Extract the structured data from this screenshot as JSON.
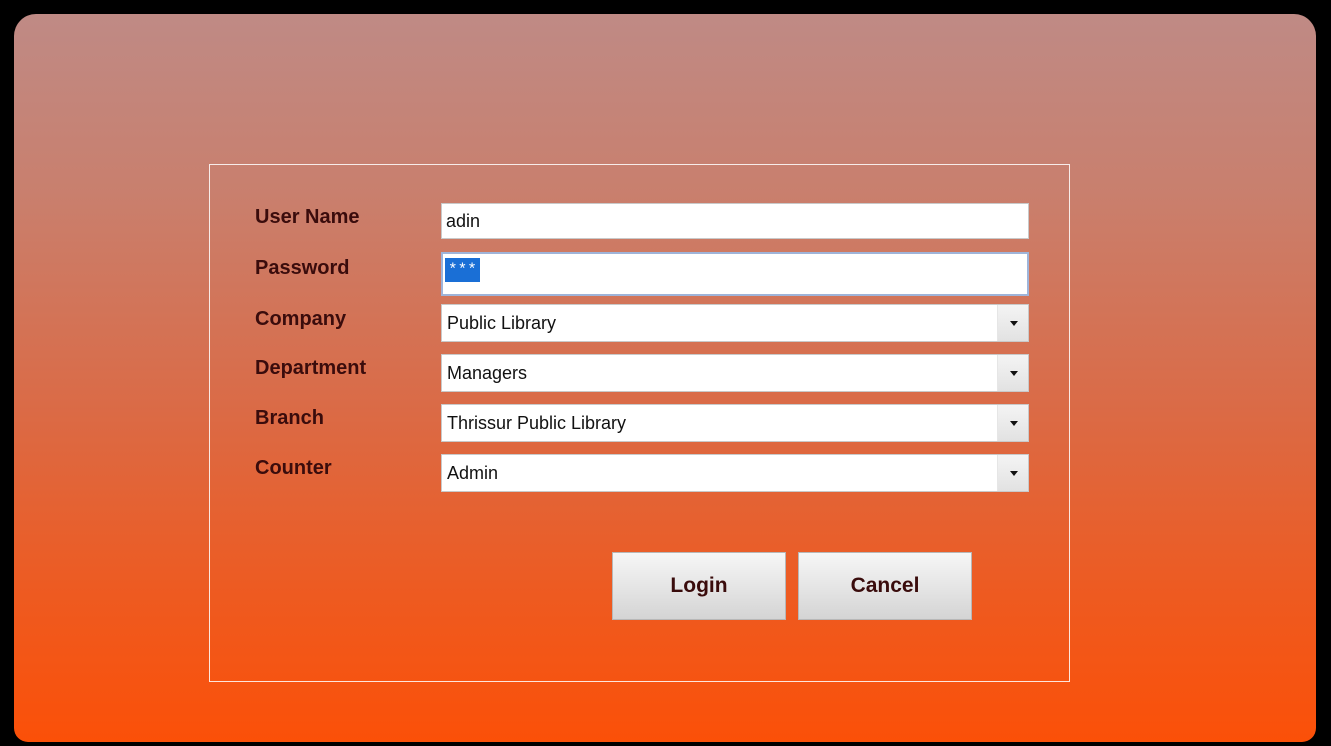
{
  "form": {
    "user_name_label": "User Name",
    "password_label": "Password",
    "company_label": "Company",
    "department_label": "Department",
    "branch_label": "Branch",
    "counter_label": "Counter",
    "user_name_value": "adin",
    "password_value": "***",
    "company_value": "Public Library",
    "department_value": "Managers",
    "branch_value": "Thrissur Public Library",
    "counter_value": "Admin"
  },
  "buttons": {
    "login_label": "Login",
    "cancel_label": "Cancel"
  },
  "colors": {
    "gradient_top": "#bf8a85",
    "gradient_bottom": "#fb5008",
    "label_color": "#3a0c0c",
    "selection_highlight": "#1a6fd6"
  },
  "icons": {
    "dropdown": "chevron-down-icon"
  }
}
